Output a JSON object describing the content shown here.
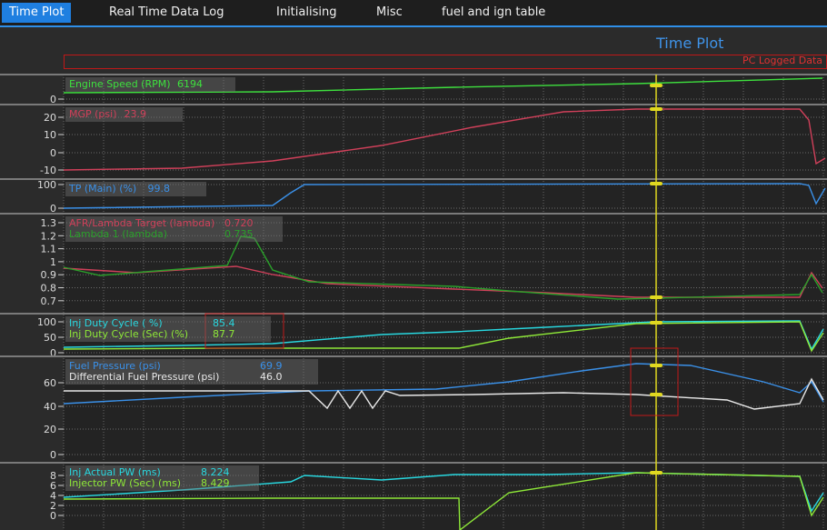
{
  "tabs": [
    {
      "label": "Time Plot",
      "active": true
    },
    {
      "label": "Real Time Data Log",
      "active": false
    },
    {
      "label": "Initialising",
      "active": false
    },
    {
      "label": "Misc",
      "active": false
    },
    {
      "label": "fuel and ign table",
      "active": false
    }
  ],
  "plot": {
    "title": "Time Plot",
    "legend": "PC Logged Data",
    "colors": {
      "accent": "#1f7fe0",
      "cursor": "#e0d820",
      "highlight": "#c01818"
    },
    "panels": [
      {
        "ticks": [
          "0"
        ],
        "channels": [
          {
            "name": "Engine Speed (RPM)",
            "value": "6194",
            "color": "#3ee03e"
          }
        ]
      },
      {
        "ticks": [
          "20",
          "10",
          "0",
          "-10"
        ],
        "channels": [
          {
            "name": "MGP (psi)",
            "value": "23.9",
            "color": "#d0405a"
          }
        ]
      },
      {
        "ticks": [
          "100",
          "0"
        ],
        "channels": [
          {
            "name": "TP (Main) (%)",
            "value": "99.8",
            "color": "#3a90e8"
          }
        ]
      },
      {
        "ticks": [
          "1.3",
          "1.2",
          "1.1",
          "1",
          "0.9",
          "0.8",
          "0.7"
        ],
        "channels": [
          {
            "name": "AFR/Lambda Target (lambda)",
            "value": "0.720",
            "color": "#d0405a"
          },
          {
            "name": "Lambda 1 (lambda)",
            "value": "0.735",
            "color": "#2aa02a"
          }
        ]
      },
      {
        "ticks": [
          "100",
          "50",
          "0"
        ],
        "channels": [
          {
            "name": "Inj Duty Cycle ( %)",
            "value": "85.4",
            "color": "#28d8e0"
          },
          {
            "name": "Inj Duty Cycle (Sec) (%)",
            "value": "87.7",
            "color": "#8ee838"
          }
        ]
      },
      {
        "ticks": [
          "60",
          "40",
          "20",
          "0"
        ],
        "channels": [
          {
            "name": "Fuel Pressure (psi)",
            "value": "69.9",
            "color": "#3a90e8"
          },
          {
            "name": "Differential Fuel Pressure (psi)",
            "value": "46.0",
            "color": "#e8e8e8"
          }
        ]
      },
      {
        "ticks": [
          "8",
          "6",
          "4",
          "2",
          "0"
        ],
        "channels": [
          {
            "name": "Inj Actual PW (ms)",
            "value": "8.224",
            "color": "#28d8e0"
          },
          {
            "name": "Injector PW (Sec) (ms)",
            "value": "8.429",
            "color": "#8ee838"
          }
        ]
      }
    ]
  }
}
